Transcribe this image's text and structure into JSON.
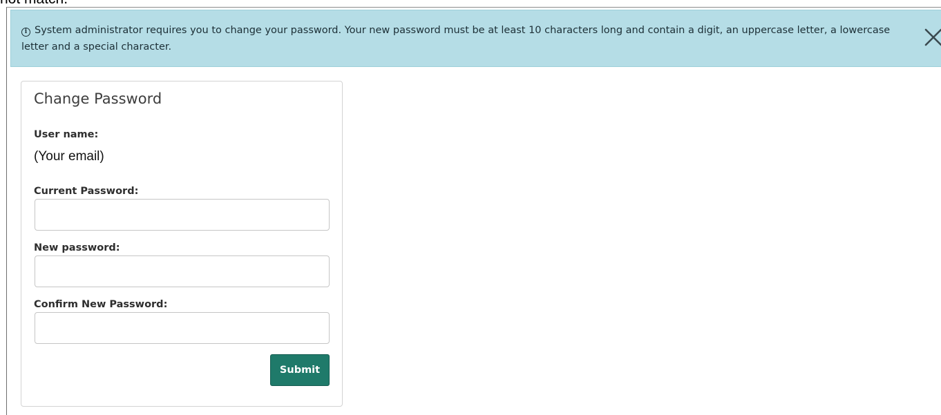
{
  "clipped_text": "not match.",
  "alert": {
    "icon": "info-icon",
    "message": "System administrator requires you to change your password. Your new password must be at least 10 characters long and contain a digit, an uppercase letter, a lowercase letter and a special character.",
    "close_icon": "close-icon"
  },
  "form": {
    "title": "Change Password",
    "username_label": "User name:",
    "username_value": "(Your email)",
    "current_password_label": "Current Password:",
    "current_password_value": "",
    "new_password_label": "New password:",
    "new_password_value": "",
    "confirm_password_label": "Confirm New Password:",
    "confirm_password_value": "",
    "submit_label": "Submit"
  },
  "colors": {
    "alert_background": "#b5dde6",
    "submit_background": "#1f7a6a"
  }
}
